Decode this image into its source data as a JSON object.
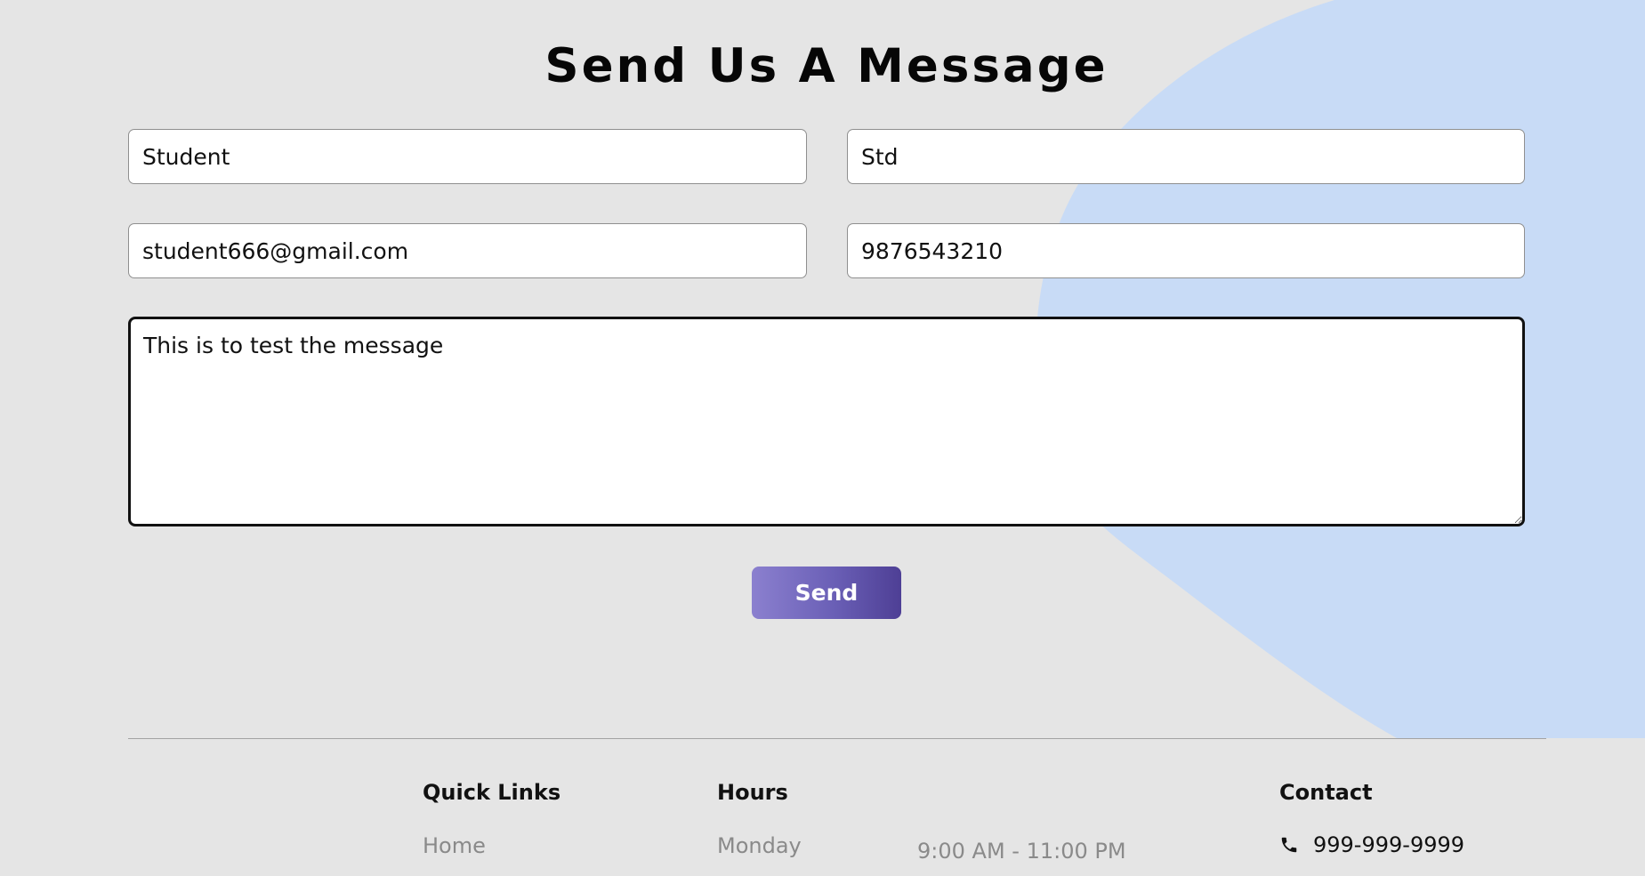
{
  "theme": {
    "background": "#e5e5e5",
    "blob_color": "#c8dbf6",
    "button_gradient": [
      "#8b80cf",
      "#4e3f95"
    ],
    "heading_color": "#060606",
    "muted_text": "#8a8a8a"
  },
  "page": {
    "title": "Send Us A Message"
  },
  "form": {
    "first_name": "Student",
    "last_name": "Std",
    "email": "student666@gmail.com",
    "phone": "9876543210",
    "message": "This is to test the message",
    "send_label": "Send"
  },
  "footer": {
    "quick_links": {
      "heading": "Quick Links",
      "items": [
        "Home"
      ]
    },
    "hours": {
      "heading": "Hours",
      "rows": [
        {
          "day": "Monday",
          "time": "9:00 AM - 11:00 PM"
        }
      ]
    },
    "contact": {
      "heading": "Contact",
      "phone_icon": "phone-icon",
      "phone": "999-999-9999"
    }
  }
}
